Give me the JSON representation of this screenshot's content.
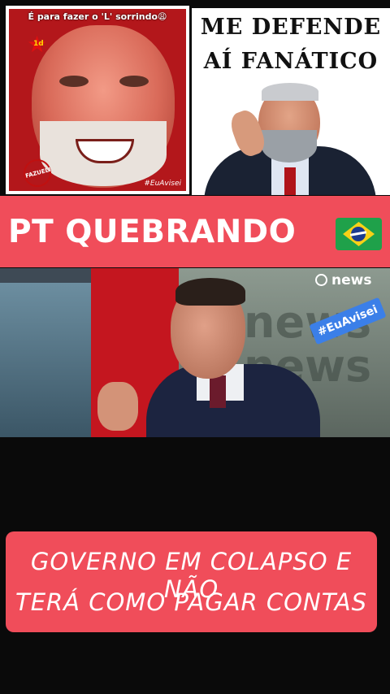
{
  "meme_left": {
    "caption": "É para fazer o 'L' sorrindo😩",
    "badge": "1d",
    "stamp": "FAZUELI",
    "watermark": "#EuAvisei"
  },
  "meme_right": {
    "line1": "ME DEFENDE",
    "line2": "AÍ FANÁTICO"
  },
  "banner_top": {
    "text": "PT QUEBRANDO"
  },
  "video": {
    "channel": "news",
    "tag": "#EuAvisei",
    "bg_text_1": "news",
    "bg_text_2": "news"
  },
  "banner_bottom": {
    "line1": "GOVERNO EM COLAPSO E NÃO",
    "line2": "TERÁ COMO PAGAR  CONTAS"
  },
  "colors": {
    "banner": "#f04d5a",
    "tag_blue": "#3b7fe8"
  }
}
